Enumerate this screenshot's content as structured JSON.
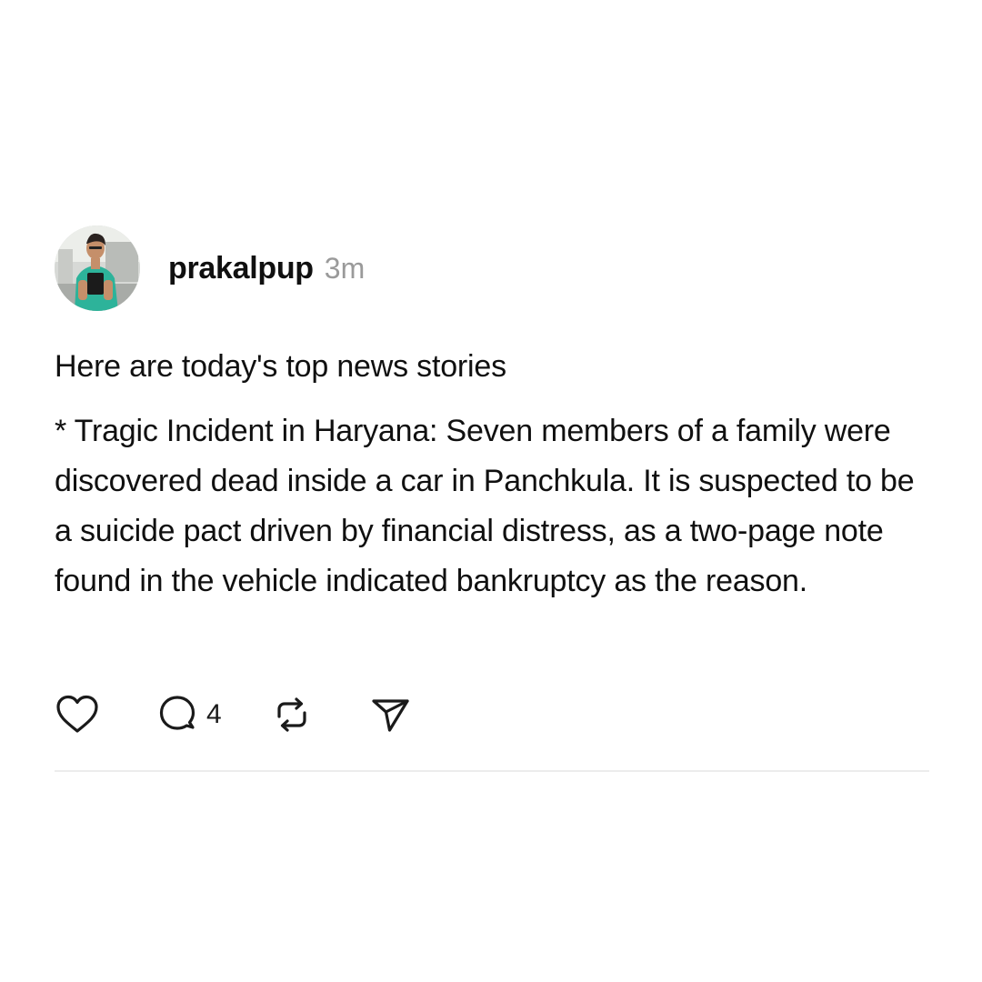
{
  "post": {
    "username": "prakalpup",
    "timestamp": "3m",
    "intro": "Here are today's top news stories",
    "text": "* Tragic Incident in Haryana: Seven members of a family were discovered dead inside a car in Panchkula. It is suspected to be a suicide pact driven by financial distress, as a two-page note found in the vehicle indicated bankruptcy as the reason."
  },
  "actions": {
    "like_icon": "heart-icon",
    "comment_icon": "comment-bubble-icon",
    "comment_count": "4",
    "repost_icon": "repost-icon",
    "share_icon": "send-icon"
  },
  "colors": {
    "background": "#ffffff",
    "text": "#101010",
    "muted": "#9a9a9a",
    "divider": "#ececec"
  }
}
